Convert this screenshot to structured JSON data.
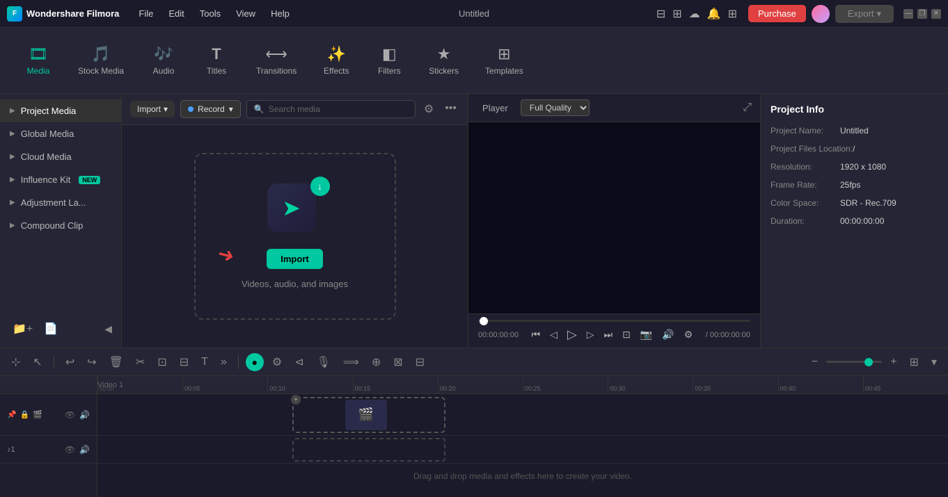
{
  "app": {
    "name": "Wondershare Filmora",
    "title": "Untitled"
  },
  "titlebar": {
    "menu_items": [
      "File",
      "Edit",
      "Tools",
      "View",
      "Help"
    ],
    "purchase_label": "Purchase",
    "export_label": "Export",
    "minimize": "—",
    "maximize": "❐",
    "close": "✕"
  },
  "toolbar": {
    "tabs": [
      {
        "id": "media",
        "label": "Media",
        "icon": "🎞"
      },
      {
        "id": "stock",
        "label": "Stock Media",
        "icon": "🎵"
      },
      {
        "id": "audio",
        "label": "Audio",
        "icon": "🎶"
      },
      {
        "id": "titles",
        "label": "Titles",
        "icon": "T"
      },
      {
        "id": "transitions",
        "label": "Transitions",
        "icon": "⟷"
      },
      {
        "id": "effects",
        "label": "Effects",
        "icon": "✨"
      },
      {
        "id": "filters",
        "label": "Filters",
        "icon": "◧"
      },
      {
        "id": "stickers",
        "label": "Stickers",
        "icon": "★"
      },
      {
        "id": "templates",
        "label": "Templates",
        "icon": "⊞"
      }
    ],
    "active_tab": "media"
  },
  "sidebar": {
    "items": [
      {
        "id": "project-media",
        "label": "Project Media",
        "active": true
      },
      {
        "id": "global-media",
        "label": "Global Media",
        "active": false
      },
      {
        "id": "cloud-media",
        "label": "Cloud Media",
        "active": false
      },
      {
        "id": "influence-kit",
        "label": "Influence Kit",
        "badge": "NEW",
        "active": false
      },
      {
        "id": "adjustment-layer",
        "label": "Adjustment La...",
        "active": false
      },
      {
        "id": "compound-clip",
        "label": "Compound Clip",
        "active": false
      }
    ]
  },
  "media_toolbar": {
    "import_label": "Import",
    "record_label": "Record",
    "search_placeholder": "Search media"
  },
  "drop_zone": {
    "import_label": "Import",
    "subtitle": "Videos, audio, and images"
  },
  "player": {
    "tab_label": "Player",
    "quality_label": "Full Quality",
    "time_current": "00:00:00:00",
    "time_separator": "/",
    "time_total": "00:00:00:00"
  },
  "project_info": {
    "title": "Project Info",
    "fields": [
      {
        "label": "Project Name:",
        "value": "Untitled"
      },
      {
        "label": "Project Files Location:",
        "value": "/"
      },
      {
        "label": "Resolution:",
        "value": "1920 x 1080"
      },
      {
        "label": "Frame Rate:",
        "value": "25fps"
      },
      {
        "label": "Color Space:",
        "value": "SDR - Rec.709"
      },
      {
        "label": "Duration:",
        "value": "00:00:00:00"
      }
    ]
  },
  "timeline": {
    "rulers": [
      "00:00:05:00",
      "00:00:10:00",
      "00:00:15:00",
      "00:00:20:00",
      "00:00:25:00",
      "00:00:30:00",
      "00:00:35:00",
      "00:00:40:00",
      "00:00:45:00"
    ],
    "track_labels": [
      "Video 1",
      "♪1"
    ],
    "empty_msg": "Drag and drop media and effects here to create your video."
  }
}
